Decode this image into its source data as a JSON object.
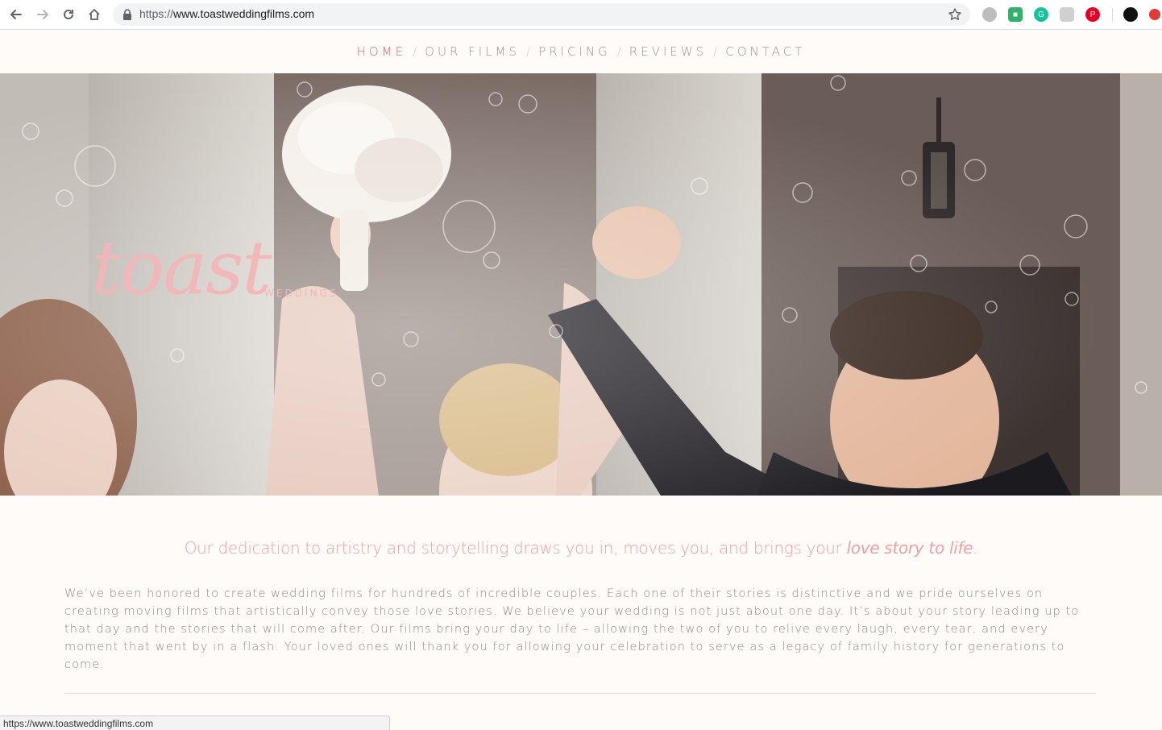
{
  "browser": {
    "url_scheme": "https://",
    "url_host": "www.toastweddingfilms.com",
    "status_url": "https://www.toastweddingfilms.com"
  },
  "nav": {
    "items": [
      {
        "label": "HOME"
      },
      {
        "label": "OUR FILMS"
      },
      {
        "label": "PRICING"
      },
      {
        "label": "REVIEWS"
      },
      {
        "label": "CONTACT"
      }
    ],
    "separator": "/",
    "active_color": "#e0606b"
  },
  "hero": {
    "logo_word": "toast",
    "logo_sub": "WEDDINGS"
  },
  "content": {
    "tagline_main": "Our dedication to artistry and storytelling draws you in, moves you, and brings your ",
    "tagline_em": "love story to life",
    "tagline_end": ".",
    "paragraph": "We’ve been honored to create wedding films for hundreds of incredible couples. Each one of their stories is distinctive and we pride ourselves on creating moving films that artistically convey those love stories. We believe your wedding is not just about one day. It’s about your story leading up to that day and the stories that will come after. Our films bring your day to life – allowing the two of you to relive every laugh, every tear, and every moment that went by in a flash. Your loved ones will thank you for allowing your celebration to serve as a legacy of family history for generations to come."
  },
  "icons": {
    "back": "arrow-left-icon",
    "forward": "arrow-right-icon",
    "reload": "reload-icon",
    "home": "home-icon",
    "lock": "lock-icon",
    "bookmark": "star-icon"
  }
}
